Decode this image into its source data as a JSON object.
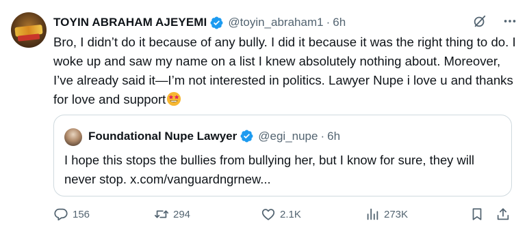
{
  "tweet": {
    "display_name": "TOYIN ABRAHAM AJEYEMI",
    "handle": "@toyin_abraham1",
    "separator": "·",
    "time": "6h",
    "text": "Bro, I didn’t do it because of any bully. I did it because it was the right thing to do. I woke up and saw my name on a list I knew absolutely nothing about. Moreover, I’ve already said it—I’m not interested in politics. Lawyer Nupe i love u and thanks for love and support",
    "emoji": "star-struck-emoji",
    "verified_color": "#1d9bf0"
  },
  "quote": {
    "display_name": "Foundational Nupe Lawyer",
    "handle": "@egi_nupe",
    "separator": "·",
    "time": "6h",
    "text": "I hope this stops the bullies from bullying her, but I know for sure, they will never stop. x.com/vanguardngrnew..."
  },
  "actions": {
    "replies": "156",
    "retweets": "294",
    "likes": "2.1K",
    "views": "273K"
  },
  "icons": [
    "grok-icon",
    "more-icon",
    "reply-icon",
    "retweet-icon",
    "like-icon",
    "views-icon",
    "bookmark-icon",
    "share-icon"
  ]
}
